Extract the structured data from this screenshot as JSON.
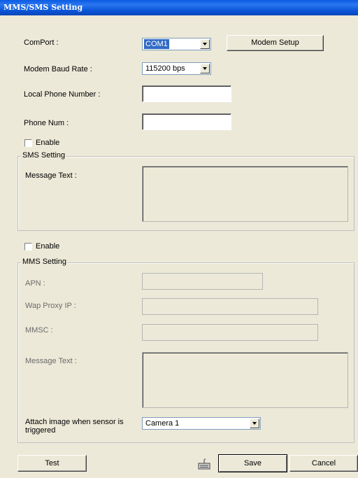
{
  "window": {
    "title": "MMS/SMS Setting"
  },
  "comport": {
    "label": "ComPort :",
    "value": "COM1"
  },
  "modem_setup_button": "Modem Setup",
  "baud": {
    "label": "Modem Baud Rate :",
    "value": "115200 bps"
  },
  "local_phone": {
    "label": "Local Phone Number :",
    "value": ""
  },
  "phone_num": {
    "label": "Phone Num :",
    "value": ""
  },
  "sms": {
    "enable_label": "Enable",
    "enabled": false,
    "group_title": "SMS Setting",
    "message_label": "Message Text :",
    "message_value": ""
  },
  "mms": {
    "enable_label": "Enable",
    "enabled": false,
    "group_title": "MMS Setting",
    "apn_label": "APN :",
    "apn_value": "",
    "wap_label": "Wap Proxy IP :",
    "wap_value": "",
    "mmsc_label": "MMSC :",
    "mmsc_value": "",
    "message_label": "Message Text :",
    "message_value": "",
    "attach_label_line1": "Attach image when sensor is",
    "attach_label_line2": "triggered",
    "camera_value": "Camera 1"
  },
  "buttons": {
    "test": "Test",
    "save": "Save",
    "cancel": "Cancel"
  },
  "icons": {
    "keyboard": "keyboard-icon"
  }
}
